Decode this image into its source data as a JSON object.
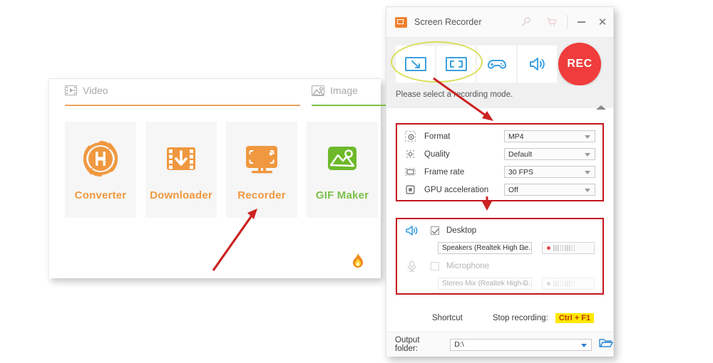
{
  "main_window": {
    "tabs": [
      {
        "label": "Video",
        "icon": "film-icon",
        "accent": "#e8a35c"
      },
      {
        "label": "Image",
        "icon": "image-icon",
        "accent": "#7cc04a"
      }
    ],
    "cards": [
      {
        "label": "Converter",
        "icon": "converter-icon",
        "color": "#f0983f"
      },
      {
        "label": "Downloader",
        "icon": "downloader-icon",
        "color": "#f0983f"
      },
      {
        "label": "Recorder",
        "icon": "recorder-icon",
        "color": "#f0983f"
      },
      {
        "label": "GIF Maker",
        "icon": "gif-maker-icon",
        "color": "#7cc04a"
      }
    ],
    "corner_icon": "flame-icon"
  },
  "recorder_window": {
    "title": "Screen Recorder",
    "title_icon": "app-logo-icon",
    "tool_icons": [
      "key-icon",
      "cart-icon"
    ],
    "window_controls": [
      "minimize-icon",
      "close-icon"
    ],
    "modes": [
      {
        "name": "region-record-mode",
        "icon": "region-capture-icon"
      },
      {
        "name": "fullscreen-record-mode",
        "icon": "fullscreen-capture-icon"
      },
      {
        "name": "game-record-mode",
        "icon": "gamepad-icon"
      },
      {
        "name": "audio-record-mode",
        "icon": "speaker-icon"
      }
    ],
    "rec_button": "REC",
    "hint": "Please select a recording mode.",
    "collapse_icon": "collapse-triangle-icon",
    "settings": [
      {
        "icon": "format-icon",
        "label": "Format",
        "value": "MP4"
      },
      {
        "icon": "quality-icon",
        "label": "Quality",
        "value": "Default"
      },
      {
        "icon": "framerate-icon",
        "label": "Frame rate",
        "value": "30 FPS"
      },
      {
        "icon": "gpu-icon",
        "label": "GPU acceleration",
        "value": "Off"
      }
    ],
    "audio": {
      "desktop": {
        "icon": "speaker-icon",
        "label": "Desktop",
        "checked": true,
        "device": "Speakers (Realtek High De...",
        "meter_dot_color": "#e04a4a"
      },
      "microphone": {
        "icon": "microphone-icon",
        "label": "Microphone",
        "checked": false,
        "device": "Stereo Mix (Realtek High D...",
        "meter_dot_color": "#9a9a9a"
      }
    },
    "shortcut": {
      "label": "Shortcut",
      "stop_label": "Stop recording:",
      "key": "Ctrl + F1",
      "key_bg": "#ffe800",
      "key_color": "#c33500"
    },
    "output": {
      "label": "Output folder:",
      "value": "D:\\",
      "browse_icon": "folder-icon"
    }
  },
  "annotations": {
    "highlight_ellipse_color": "#d9de5a",
    "arrow_color": "#cc2222",
    "box_color": "#c4161c"
  }
}
